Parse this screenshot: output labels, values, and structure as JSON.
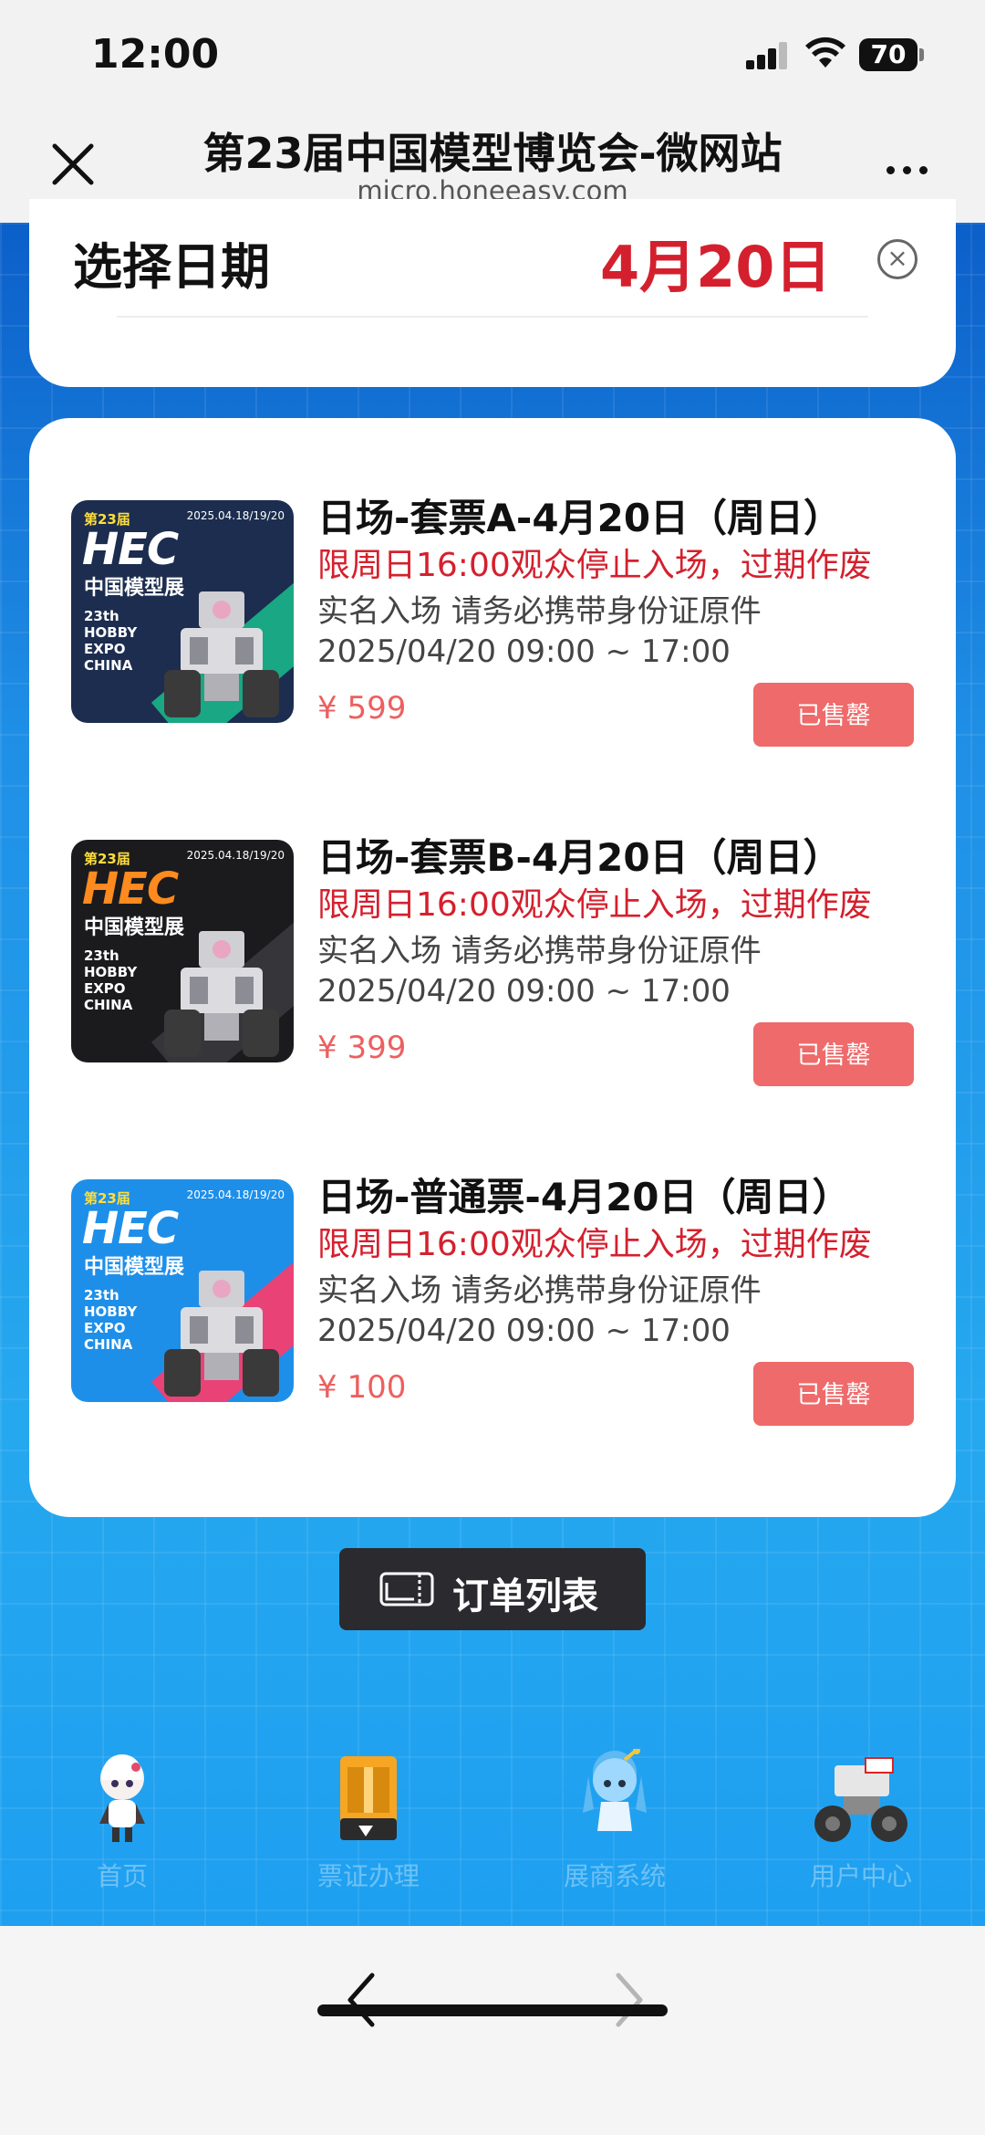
{
  "status_bar": {
    "time": "12:00",
    "battery": "70"
  },
  "nav": {
    "title": "第23届中国模型博览会-微网站",
    "url": "micro.honeeasy.com"
  },
  "date_selector": {
    "label": "选择日期",
    "value": "4月20日"
  },
  "tickets": [
    {
      "title": "日场-套票A-4月20日（周日）",
      "warning": "限周日16:00观众停止入场，过期作废",
      "info": "实名入场 请务必携带身份证原件",
      "time": "2025/04/20 09:00 ~ 17:00",
      "price": "¥  599",
      "button": "已售罄",
      "poster": {
        "bg": "#1c2d4f",
        "stripe": "#19b58a",
        "hec_color": "#ffffff"
      }
    },
    {
      "title": "日场-套票B-4月20日（周日）",
      "warning": "限周日16:00观众停止入场，过期作废",
      "info": "实名入场 请务必携带身份证原件",
      "time": "2025/04/20 09:00 ~ 17:00",
      "price": "¥  399",
      "button": "已售罄",
      "poster": {
        "bg": "#1b1b1d",
        "stripe": "#3a3a3e",
        "hec_color": "#ff8a1f"
      }
    },
    {
      "title": "日场-普通票-4月20日（周日）",
      "warning": "限周日16:00观众停止入场，过期作废",
      "info": "实名入场 请务必携带身份证原件",
      "time": "2025/04/20 09:00 ~ 17:00",
      "price": "¥  100",
      "button": "已售罄",
      "poster": {
        "bg": "#1e8fe9",
        "stripe": "#ff3a6a",
        "hec_color": "#ffffff"
      }
    }
  ],
  "poster_text": {
    "badge": "第23届",
    "date": "2025.04.18/19/20",
    "hec": "HEC",
    "cn": "中国模型展",
    "en": "23th\nHOBBY\nEXPO\nCHINA"
  },
  "order_button": {
    "label": "订单列表",
    "icon": "ticket-icon"
  },
  "tabs": [
    {
      "label": "首页",
      "icon": "home-mascot-icon"
    },
    {
      "label": "票证办理",
      "icon": "3d-printer-icon"
    },
    {
      "label": "展商系统",
      "icon": "exhibitor-mascot-icon"
    },
    {
      "label": "用户中心",
      "icon": "robot-vehicle-icon"
    }
  ],
  "colors": {
    "accent_red": "#d4202e",
    "soldout": "#ef6a6a",
    "bg_blue": "#1a8ae8"
  }
}
